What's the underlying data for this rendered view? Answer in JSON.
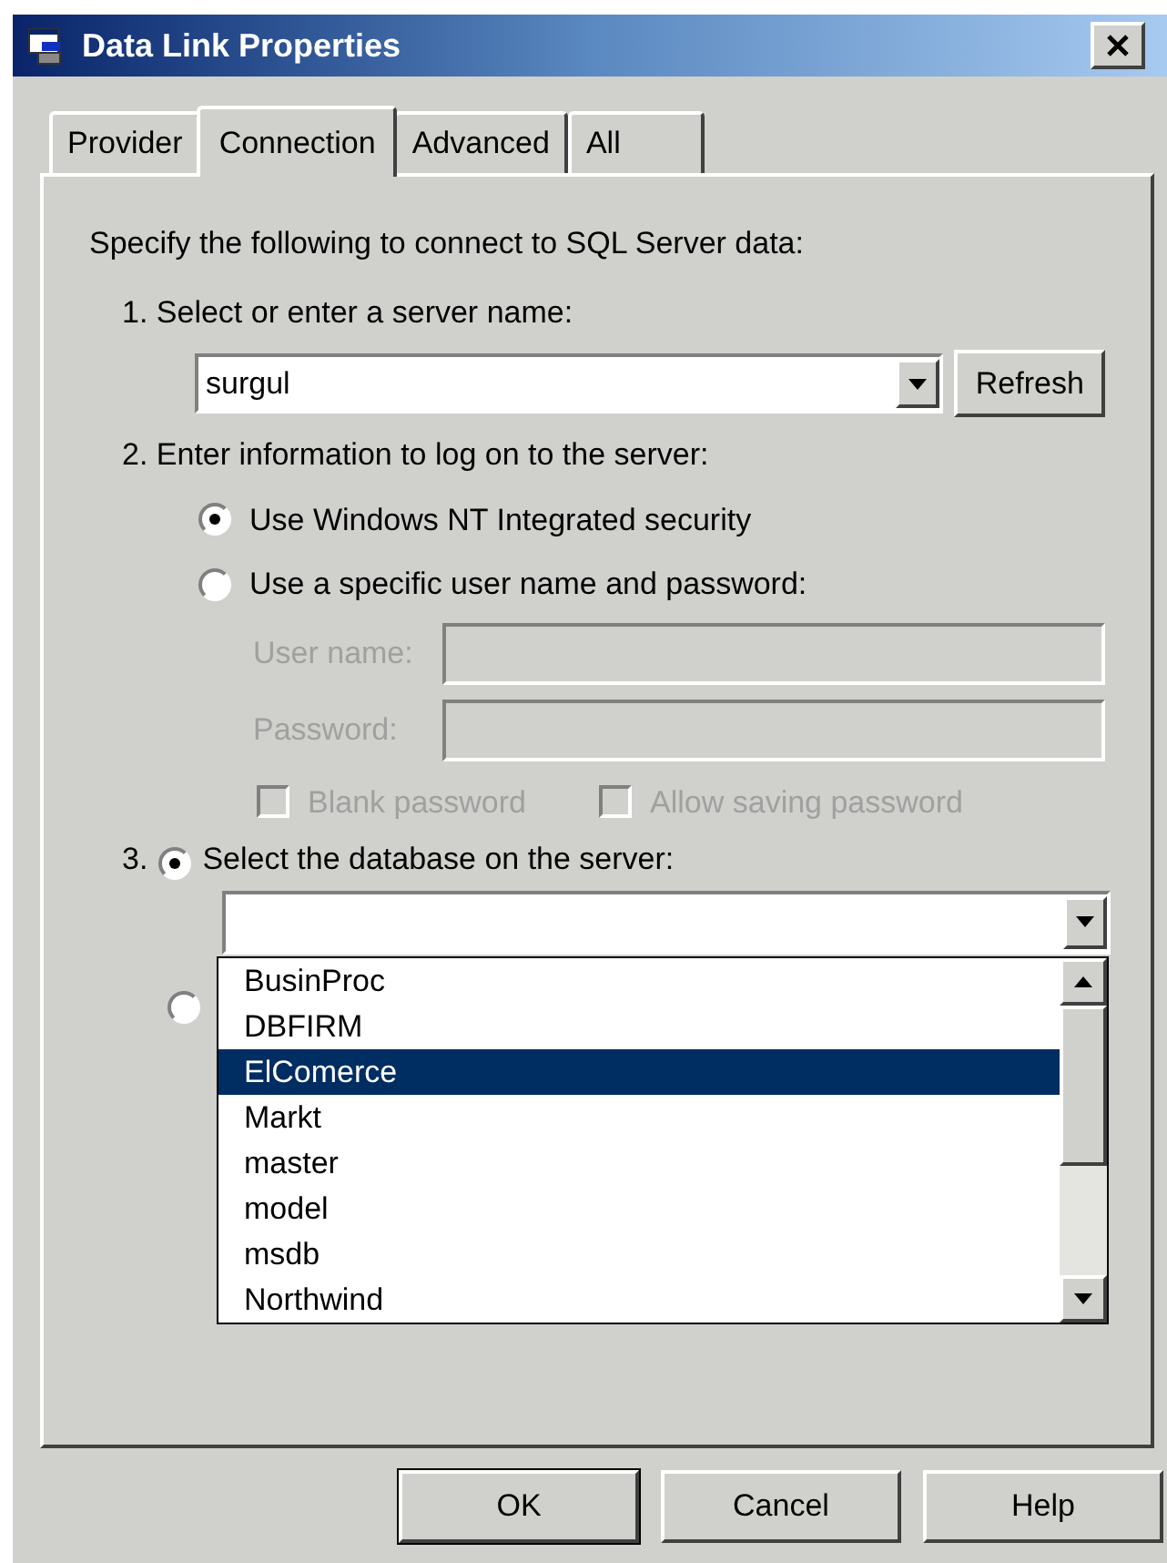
{
  "window": {
    "title": "Data Link Properties"
  },
  "tabs": [
    {
      "label": "Provider",
      "selected": false
    },
    {
      "label": "Connection",
      "selected": true
    },
    {
      "label": "Advanced",
      "selected": false
    },
    {
      "label": "All",
      "selected": false
    }
  ],
  "instructions": "Specify the following to connect to SQL Server data:",
  "step_1": {
    "label": "1. Select or enter a server name:",
    "server_field": {
      "value": "surgul"
    },
    "refresh_button": "Refresh"
  },
  "step_2": {
    "label": "2. Enter information to log on to the server:",
    "auth_options": [
      {
        "label": "Use Windows NT Integrated security",
        "selected": true
      },
      {
        "label": "Use a specific user name and password:",
        "selected": false
      }
    ],
    "fields": [
      {
        "label": "User name:",
        "disabled": true
      },
      {
        "label": "Password:",
        "disabled": true
      }
    ],
    "checkboxes": [
      {
        "label": "Blank password",
        "checked": false,
        "disabled": true
      },
      {
        "label": "Allow saving password",
        "checked": false,
        "disabled": true
      }
    ]
  },
  "step_3": {
    "number": "3.",
    "label": "Select the database on the server:",
    "selected": true,
    "second_option_selected": false,
    "database_list": [
      {
        "label": "BusinProc",
        "selected": false
      },
      {
        "label": "DBFIRM",
        "selected": false
      },
      {
        "label": "ElComerce",
        "selected": true
      },
      {
        "label": "Markt",
        "selected": false
      },
      {
        "label": "master",
        "selected": false
      },
      {
        "label": "model",
        "selected": false
      },
      {
        "label": "msdb",
        "selected": false
      },
      {
        "label": "Northwind",
        "selected": false
      }
    ]
  },
  "buttons": [
    "OK",
    "Cancel",
    "Help"
  ]
}
